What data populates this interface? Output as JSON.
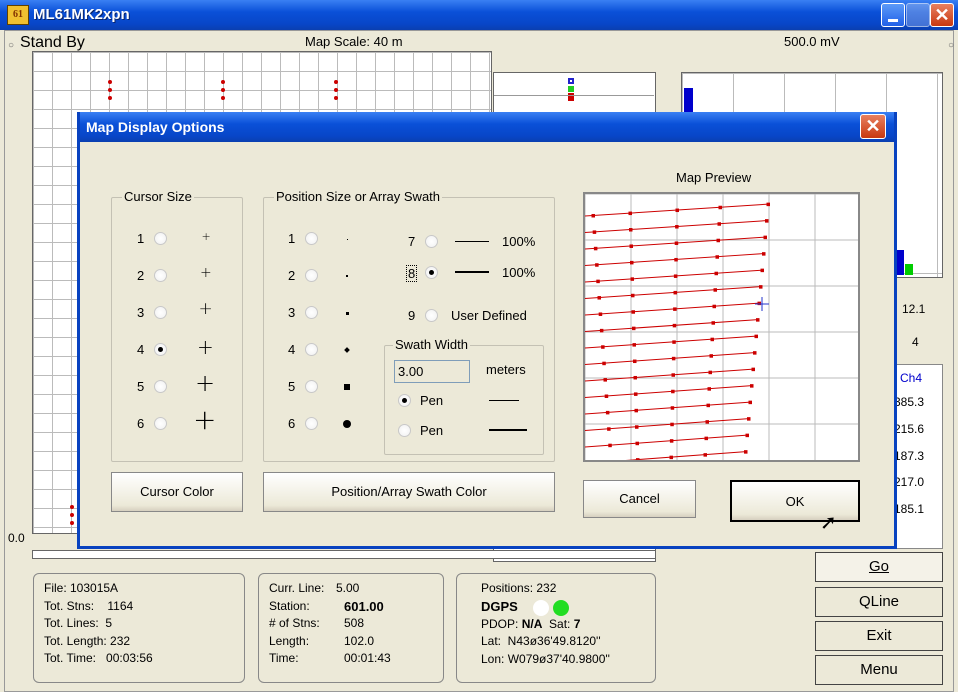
{
  "window": {
    "title": "ML61MK2xpn",
    "icon_text": "61"
  },
  "main": {
    "status": "Stand By",
    "map_scale": "Map Scale:  40 m",
    "voltage": "500.0 mV",
    "left_value": "0.0",
    "right_vals": [
      "12.1",
      "4"
    ],
    "channel_header": "Ch4",
    "channel_values": [
      "385.3",
      "215.6",
      "187.3",
      "217.0",
      "185.1"
    ]
  },
  "file_panel": {
    "lines": [
      "File: 103015A",
      "Tot. Stns:    1164",
      "Tot. Lines:  5",
      "Tot. Length: 232",
      "Tot. Time:   00:03:56"
    ]
  },
  "line_panel": {
    "labels": [
      "Curr. Line:",
      "Station:",
      "# of Stns:",
      "Length:",
      "Time:"
    ],
    "values": [
      "5.00",
      "601.00",
      "508",
      "102.0",
      "00:01:43"
    ]
  },
  "pos_panel": {
    "positions": "Positions: 232",
    "dgps": "DGPS",
    "pdop_label": "PDOP:",
    "pdop_value": "N/A",
    "sat_label": "Sat:",
    "sat_value": "7",
    "lat": "Lat:  N43ø36'49.8120''",
    "lon": "Lon: W079ø37'40.9800''"
  },
  "buttons": {
    "go": "Go",
    "qline": "QLine",
    "exit": "Exit",
    "menu": "Menu"
  },
  "dialog": {
    "title": "Map Display Options",
    "cursor_group": "Cursor Size",
    "cursor_options": [
      "1",
      "2",
      "3",
      "4",
      "5",
      "6"
    ],
    "cursor_selected": "4",
    "position_group": "Position Size or Array Swath",
    "position_options": [
      "1",
      "2",
      "3",
      "4",
      "5",
      "6"
    ],
    "swath_options": [
      {
        "n": "7",
        "pct": "100%"
      },
      {
        "n": "8",
        "pct": "100%"
      },
      {
        "n": "9",
        "label": "User Defined"
      }
    ],
    "swath_selected": "8",
    "swath_width_group": "Swath Width",
    "swath_width_value": "3.00",
    "swath_width_unit": "meters",
    "pen_options": [
      "Pen",
      "Pen"
    ],
    "pen_selected": 0,
    "map_preview_label": "Map Preview",
    "cursor_color_button": "Cursor Color",
    "swath_color_button": "Position/Array Swath Color",
    "cancel_button": "Cancel",
    "ok_button": "OK"
  },
  "colors": {
    "title_blue": "#0a50d8",
    "marker_red": "#cc0000",
    "dgps_green": "#22dd22",
    "cursor_blue": "#2233cc"
  }
}
